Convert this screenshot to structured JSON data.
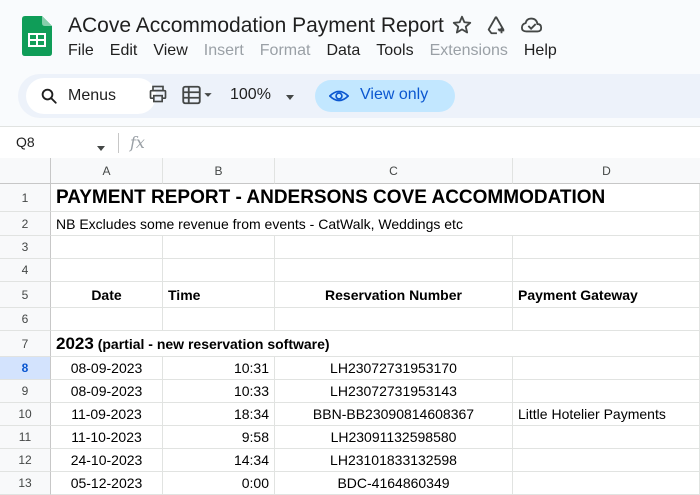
{
  "app": {
    "doc_title": "ACove Accommodation Payment Report",
    "menus": [
      {
        "label": "File",
        "disabled": false
      },
      {
        "label": "Edit",
        "disabled": false
      },
      {
        "label": "View",
        "disabled": false
      },
      {
        "label": "Insert",
        "disabled": true
      },
      {
        "label": "Format",
        "disabled": true
      },
      {
        "label": "Data",
        "disabled": false
      },
      {
        "label": "Tools",
        "disabled": false
      },
      {
        "label": "Extensions",
        "disabled": true
      },
      {
        "label": "Help",
        "disabled": false
      }
    ]
  },
  "toolbar": {
    "search_label": "Menus",
    "zoom": "100%",
    "view_only_label": "View only"
  },
  "formula_bar": {
    "name_box": "Q8",
    "fx": "fx"
  },
  "columns": [
    "A",
    "B",
    "C",
    "D"
  ],
  "rows": [
    {
      "num": "1",
      "cells": {
        "A": "PAYMENT REPORT - ANDERSONS COVE ACCOMMODATION"
      }
    },
    {
      "num": "2",
      "cells": {
        "A": "NB Excludes some revenue from events - CatWalk, Weddings etc"
      }
    },
    {
      "num": "3",
      "cells": {}
    },
    {
      "num": "4",
      "cells": {}
    },
    {
      "num": "5",
      "cells": {
        "A": "Date",
        "B": "Time",
        "C": "Reservation Number",
        "D": "Payment Gateway"
      }
    },
    {
      "num": "6",
      "cells": {}
    },
    {
      "num": "7",
      "cells": {
        "A_year": "2023",
        "A_note": "(partial - new reservation software)"
      }
    },
    {
      "num": "8",
      "cells": {
        "A": "08-09-2023",
        "B": "10:31",
        "C": "LH23072731953170",
        "D": ""
      }
    },
    {
      "num": "9",
      "cells": {
        "A": "08-09-2023",
        "B": "10:33",
        "C": "LH23072731953143",
        "D": ""
      }
    },
    {
      "num": "10",
      "cells": {
        "A": "11-09-2023",
        "B": "18:34",
        "C": "BBN-BB23090814608367",
        "D": "Little Hotelier Payments"
      }
    },
    {
      "num": "11",
      "cells": {
        "A": "11-10-2023",
        "B": "9:58",
        "C": "LH23091132598580",
        "D": ""
      }
    },
    {
      "num": "12",
      "cells": {
        "A": "24-10-2023",
        "B": "14:34",
        "C": "LH23101833132598",
        "D": ""
      }
    },
    {
      "num": "13",
      "cells": {
        "A": "05-12-2023",
        "B": "0:00",
        "C": "BDC-4164860349",
        "D": ""
      }
    }
  ]
}
